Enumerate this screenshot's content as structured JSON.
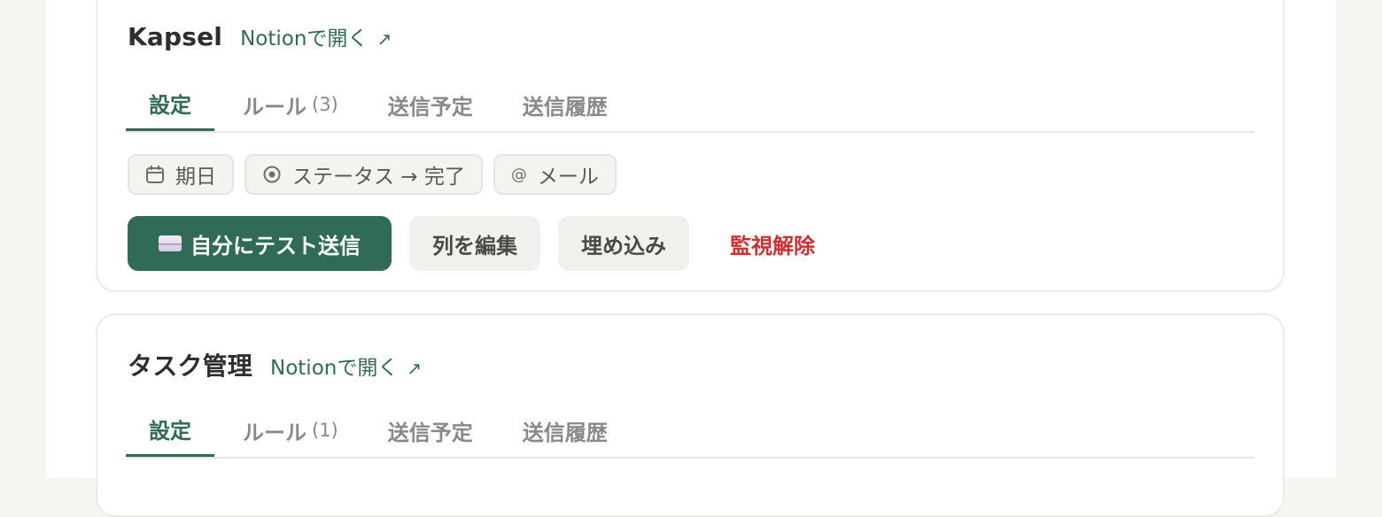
{
  "colors": {
    "accent": "#2f6b57",
    "danger": "#d12f2f",
    "chip_bg": "#f4f3ef",
    "page_bg": "#f6f5f1"
  },
  "databases": [
    {
      "title": "Kapsel",
      "open_link": "Notionで開く",
      "open_icon": "external-arrow-icon",
      "tabs": [
        {
          "label": "設定",
          "count": ""
        },
        {
          "label": "ルール",
          "count": "(3)"
        },
        {
          "label": "送信予定",
          "count": ""
        },
        {
          "label": "送信履歴",
          "count": ""
        }
      ],
      "active_tab": "設定",
      "chips": [
        {
          "icon": "calendar-icon",
          "label": "期日"
        },
        {
          "icon": "status-target-icon",
          "label": "ステータス → 完了"
        },
        {
          "icon": "at-sign-icon",
          "label": "メール"
        }
      ],
      "actions": {
        "test_send": "自分にテスト送信",
        "edit_columns": "列を編集",
        "embed": "埋め込み",
        "unwatch": "監視解除"
      }
    },
    {
      "title": "タスク管理",
      "open_link": "Notionで開く",
      "open_icon": "external-arrow-icon",
      "tabs": [
        {
          "label": "設定",
          "count": ""
        },
        {
          "label": "ルール",
          "count": "(1)"
        },
        {
          "label": "送信予定",
          "count": ""
        },
        {
          "label": "送信履歴",
          "count": ""
        }
      ],
      "active_tab": "設定"
    }
  ]
}
